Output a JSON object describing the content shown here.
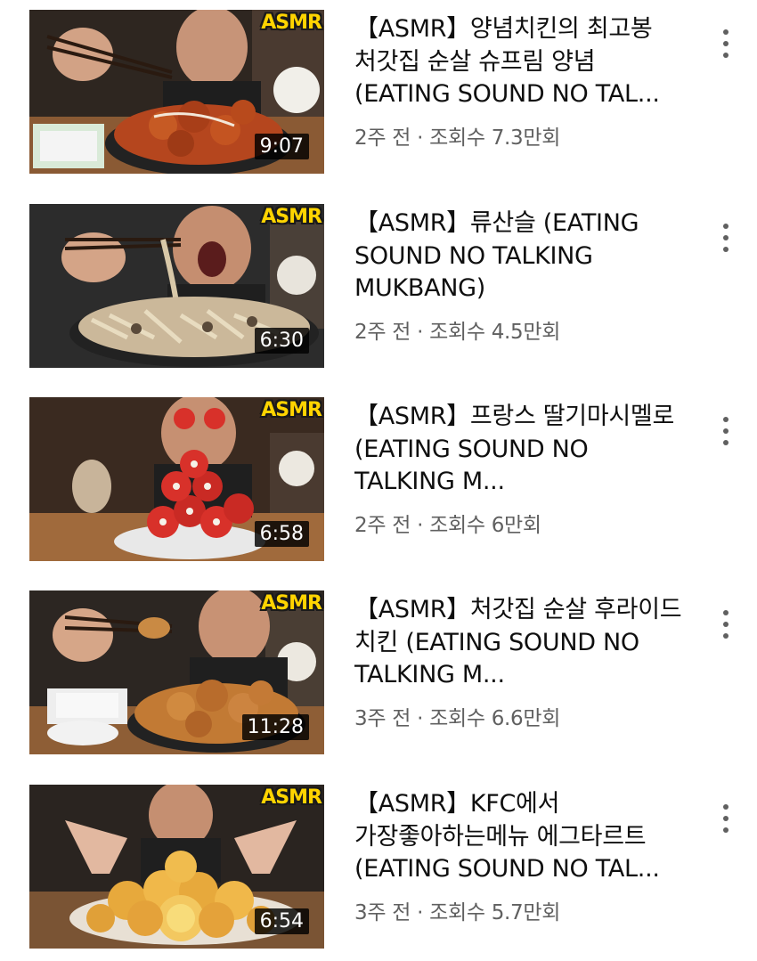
{
  "videos": [
    {
      "title": "【ASMR】양념치킨의 최고봉 처갓집 순살 슈프림 양념 (EATING SOUND NO TAL...",
      "age": "2주 전",
      "views": "조회수 7.3만회",
      "duration": "9:07",
      "badge": "ASMR",
      "thumb_scene": "fried-chicken-sauce"
    },
    {
      "title": "【ASMR】류산슬 (EATING SOUND NO TALKING MUKBANG)",
      "age": "2주 전",
      "views": "조회수 4.5만회",
      "duration": "6:30",
      "badge": "ASMR",
      "thumb_scene": "seafood-stirfry"
    },
    {
      "title": "【ASMR】프랑스 딸기마시멜로 (EATING SOUND NO TALKING M...",
      "age": "2주 전",
      "views": "조회수 6만회",
      "duration": "6:58",
      "badge": "ASMR",
      "thumb_scene": "strawberry-marshmallows"
    },
    {
      "title": "【ASMR】처갓집 순살 후라이드 치킨 (EATING SOUND NO TALKING M...",
      "age": "3주 전",
      "views": "조회수 6.6만회",
      "duration": "11:28",
      "badge": "ASMR",
      "thumb_scene": "fried-chicken"
    },
    {
      "title": "【ASMR】KFC에서 가장좋아하는메뉴 에그타르트 (EATING SOUND NO TAL...",
      "age": "3주 전",
      "views": "조회수 5.7만회",
      "duration": "6:54",
      "badge": "ASMR",
      "thumb_scene": "egg-tarts"
    }
  ],
  "separator": " · ",
  "colors": {
    "title": "#0f0f0f",
    "meta": "#606060",
    "badge_fill": "#ffd400",
    "duration_bg": "#000000"
  }
}
